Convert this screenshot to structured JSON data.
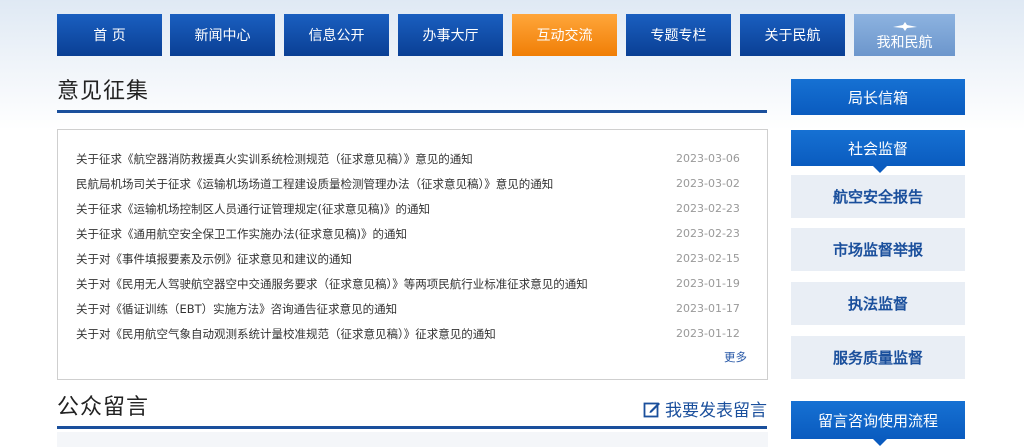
{
  "nav": {
    "items": [
      {
        "label": "首 页"
      },
      {
        "label": "新闻中心"
      },
      {
        "label": "信息公开"
      },
      {
        "label": "办事大厅"
      },
      {
        "label": "互动交流"
      },
      {
        "label": "专题专栏"
      },
      {
        "label": "关于民航"
      },
      {
        "label": "我和民航"
      }
    ],
    "active_index": 4
  },
  "opinion": {
    "title": "意见征集",
    "more_label": "更多",
    "items": [
      {
        "title": "关于征求《航空器消防救援真火实训系统检测规范（征求意见稿）》意见的通知",
        "date": "2023-03-06"
      },
      {
        "title": "民航局机场司关于征求《运输机场场道工程建设质量检测管理办法（征求意见稿）》意见的通知",
        "date": "2023-03-02"
      },
      {
        "title": "关于征求《运输机场控制区人员通行证管理规定(征求意见稿)》的通知",
        "date": "2023-02-23"
      },
      {
        "title": "关于征求《通用航空安全保卫工作实施办法(征求意见稿)》的通知",
        "date": "2023-02-23"
      },
      {
        "title": "关于对《事件填报要素及示例》征求意见和建议的通知",
        "date": "2023-02-15"
      },
      {
        "title": "关于对《民用无人驾驶航空器空中交通服务要求（征求意见稿）》等两项民航行业标准征求意见的通知",
        "date": "2023-01-19"
      },
      {
        "title": "关于对《循证训练（EBT）实施方法》咨询通告征求意见的通知",
        "date": "2023-01-17"
      },
      {
        "title": "关于对《民用航空气象自动观测系统计量校准规范（征求意见稿）》征求意见的通知",
        "date": "2023-01-12"
      }
    ]
  },
  "public_msg": {
    "title": "公众留言",
    "post_label": "我要发表留言"
  },
  "sidebar": {
    "director_mailbox": "局长信箱",
    "social_supervision": "社会监督",
    "sub_items": [
      "航空安全报告",
      "市场监督举报",
      "执法监督",
      "服务质量监督"
    ],
    "consult_process": "留言咨询使用流程"
  },
  "colors": {
    "nav_blue": "#0a3f94",
    "nav_active": "#f07e06",
    "accent_blue": "#1a4f9c",
    "side_blue": "#0a5bbf"
  }
}
